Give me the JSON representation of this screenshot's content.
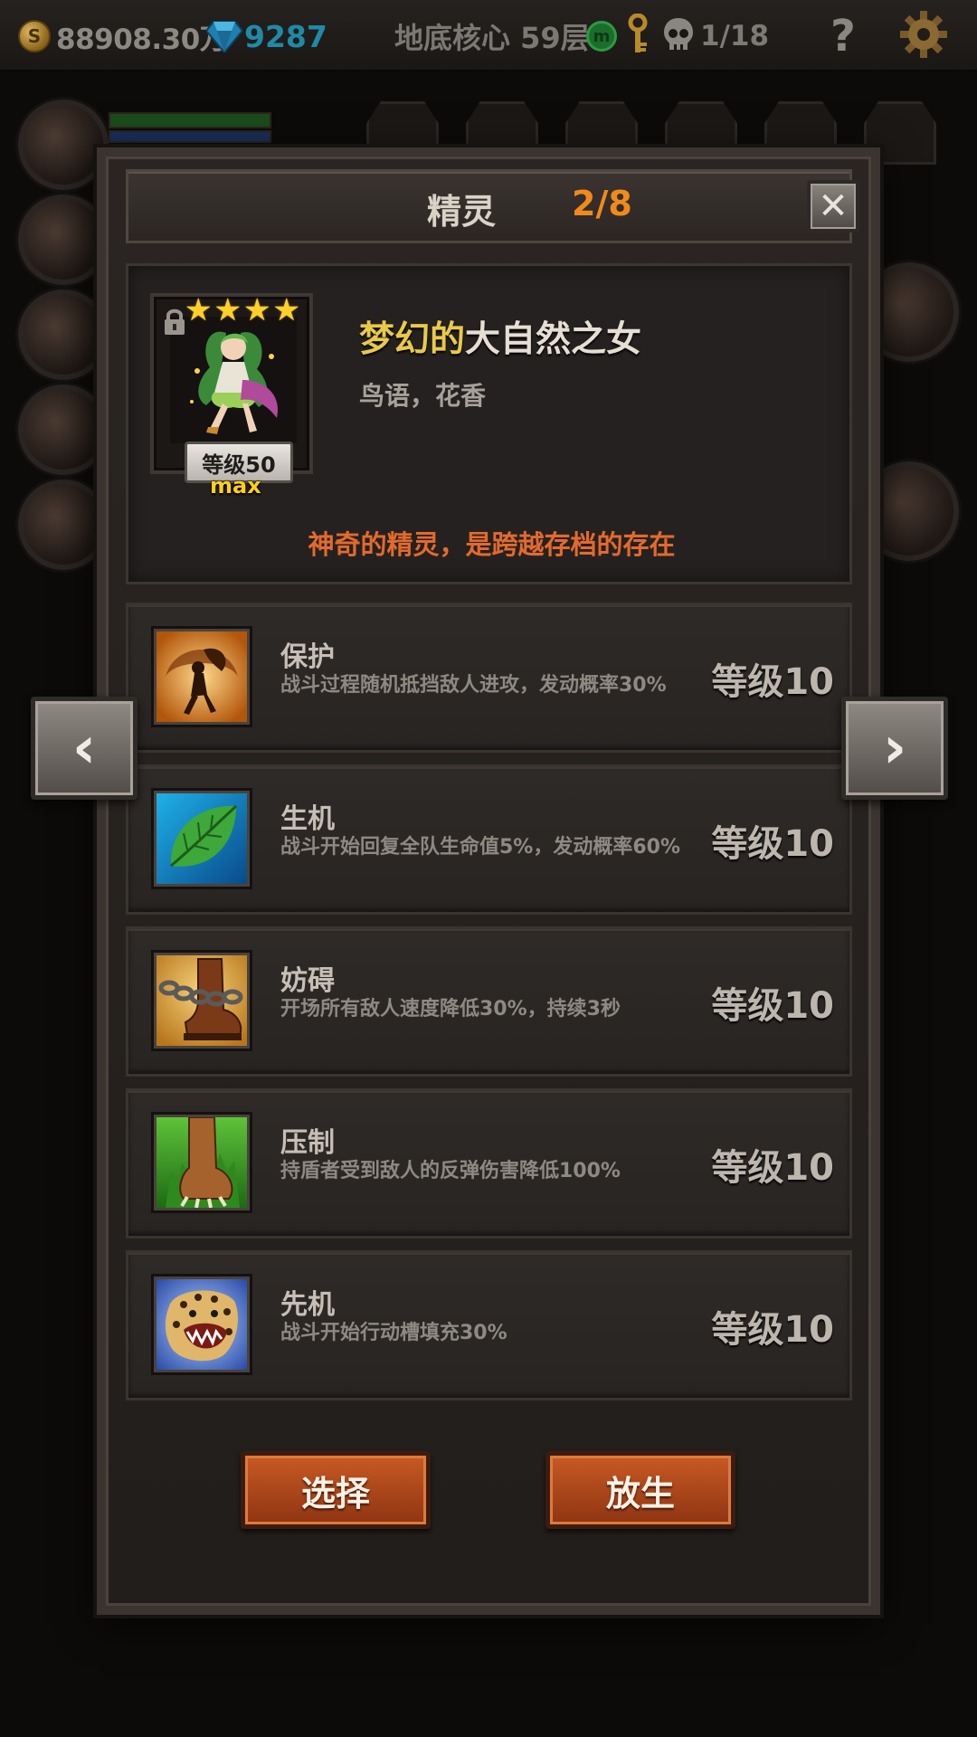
{
  "topbar": {
    "gold": "88908.30万",
    "gems": "9287",
    "floor": "地底核心 59层",
    "skulls": "1/18",
    "help": "?",
    "coin_symbol": "S",
    "green_symbol": "m",
    "icons": [
      "coin-icon",
      "gem-icon",
      "green-token-icon",
      "key-icon",
      "skull-icon",
      "help-icon",
      "settings-gear-icon"
    ]
  },
  "modal": {
    "title": "精灵",
    "counter": "2/8",
    "close": "✕"
  },
  "hero": {
    "stars": 4,
    "level": "等级50",
    "max": "max",
    "name_prefix": "梦幻的",
    "name_main": "大自然之女",
    "subtitle": "鸟语，花香",
    "description": "神奇的精灵，是跨越存档的存在"
  },
  "skills": [
    {
      "name": "保护",
      "description": "战斗过程随机抵挡敌人进攻，发动概率30%",
      "level": "等级10",
      "icon": "fairy-shield-icon"
    },
    {
      "name": "生机",
      "description": "战斗开始回复全队生命值5%，发动概率60%",
      "level": "等级10",
      "icon": "leaf-icon"
    },
    {
      "name": "妨碍",
      "description": "开场所有敌人速度降低30%，持续3秒",
      "level": "等级10",
      "icon": "chained-boot-icon"
    },
    {
      "name": "压制",
      "description": "持盾者受到敌人的反弹伤害降低100%",
      "level": "等级10",
      "icon": "beast-claw-icon"
    },
    {
      "name": "先机",
      "description": "战斗开始行动槽填充30%",
      "level": "等级10",
      "icon": "leopard-icon"
    }
  ],
  "nav": {
    "prev": "‹",
    "next": "›"
  },
  "actions": {
    "select": "选择",
    "release": "放生"
  },
  "colors": {
    "counter": "#f08a1c",
    "name_prefix": "#e9c949",
    "description": "#e36a2d",
    "gem": "#1f8aa6",
    "button": "#c85a24"
  }
}
